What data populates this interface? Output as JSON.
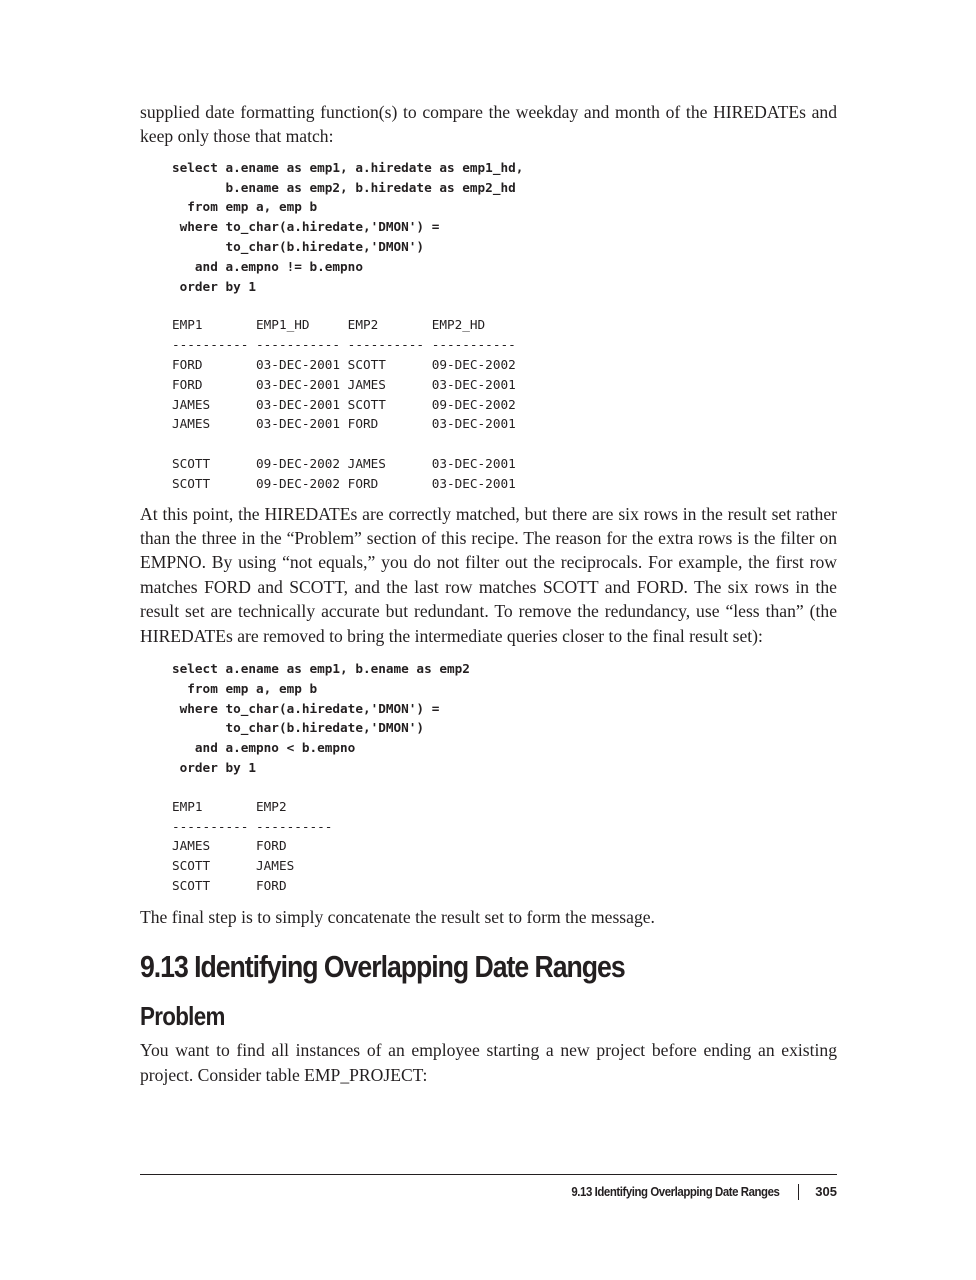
{
  "paragraphs": {
    "p1": "supplied date formatting function(s) to compare the weekday and month of the HIR­EDATEs and keep only those that match:",
    "p2": "At this point, the HIREDATEs are correctly matched, but there are six rows in the result set rather than the three in the “Problem” section of this recipe. The reason for the extra rows is the filter on EMPNO. By using “not equals,” you do not filter out the reciprocals. For example, the first row matches FORD and SCOTT, and the last row matches SCOTT and FORD. The six rows in the result set are technically accurate but redundant. To remove the redundancy, use “less than” (the HIREDATEs are removed to bring the intermediate queries closer to the final result set):",
    "p3": "The final step is to simply concatenate the result set to form the message.",
    "p4": "You want to find all instances of an employee starting a new project before ending an existing project. Consider table EMP_PROJECT:"
  },
  "code": {
    "query1": "select a.ename as emp1, a.hiredate as emp1_hd,\n       b.ename as emp2, b.hiredate as emp2_hd\n  from emp a, emp b\n where to_char(a.hiredate,'DMON') =\n       to_char(b.hiredate,'DMON')\n   and a.empno != b.empno\n order by 1",
    "result1": "EMP1       EMP1_HD     EMP2       EMP2_HD\n---------- ----------- ---------- -----------\nFORD       03-DEC-2001 SCOTT      09-DEC-2002\nFORD       03-DEC-2001 JAMES      03-DEC-2001\nJAMES      03-DEC-2001 SCOTT      09-DEC-2002\nJAMES      03-DEC-2001 FORD       03-DEC-2001\n\nSCOTT      09-DEC-2002 JAMES      03-DEC-2001\nSCOTT      09-DEC-2002 FORD       03-DEC-2001",
    "query2": "select a.ename as emp1, b.ename as emp2\n  from emp a, emp b\n where to_char(a.hiredate,'DMON') =\n       to_char(b.hiredate,'DMON')\n   and a.empno < b.empno\n order by 1",
    "result2": "EMP1       EMP2\n---------- ----------\nJAMES      FORD\nSCOTT      JAMES\nSCOTT      FORD"
  },
  "headings": {
    "section": "9.13 Identifying Overlapping Date Ranges",
    "problem": "Problem"
  },
  "footer": {
    "title": "9.13 Identifying Overlapping Date Ranges",
    "page_number": "305"
  }
}
